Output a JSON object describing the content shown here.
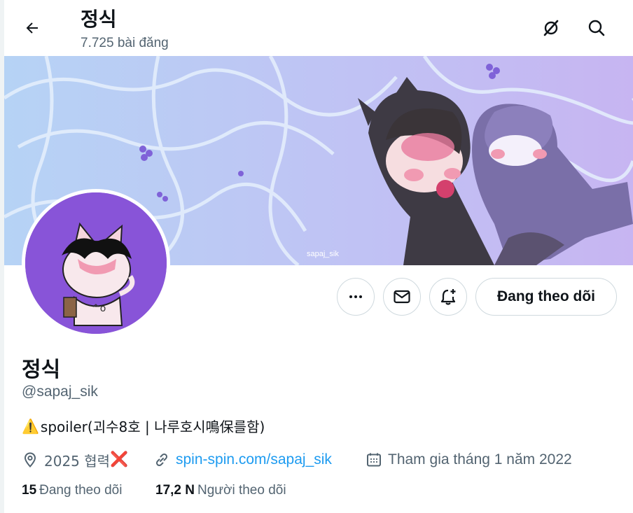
{
  "header": {
    "title": "정식",
    "post_count": "7.725 bài đăng"
  },
  "profile": {
    "display_name": "정식",
    "handle": "@sapaj_sik",
    "bio": "spoiler(괴수8호 | 나루호시鳴保를함)",
    "bio_prefix_emoji": "⚠️",
    "location": "2025 협력",
    "location_suffix_emoji": "❌",
    "website": "spin-spin.com/sapaj_sik",
    "joined": "Tham gia tháng 1 năm 2022",
    "banner_watermark": "sapaj_sik"
  },
  "stats": {
    "following_count": "15",
    "following_label": "Đang theo dõi",
    "followers_count": "17,2 N",
    "followers_label": "Người theo dõi"
  },
  "actions": {
    "follow_label": "Đang theo dõi"
  },
  "icons": {
    "back": "arrow-left-icon",
    "grok": "grok-icon",
    "search": "search-icon",
    "more": "more-icon",
    "message": "mail-icon",
    "notify": "bell-add-icon",
    "location": "location-pin-icon",
    "link": "link-icon",
    "calendar": "calendar-icon"
  },
  "colors": {
    "accent": "#1d9bf0",
    "secondary_text": "#536471",
    "avatar_bg": "#8854d8"
  }
}
